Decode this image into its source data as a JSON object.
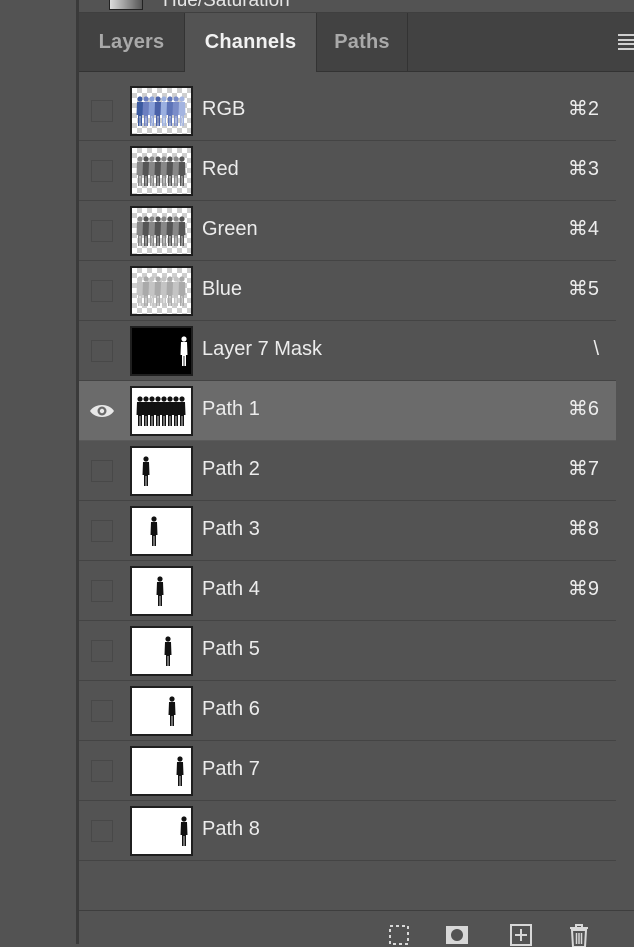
{
  "adjustment": {
    "label": "Hue/Saturation"
  },
  "tabs": [
    {
      "label": "Layers",
      "active": false
    },
    {
      "label": "Channels",
      "active": true
    },
    {
      "label": "Paths",
      "active": false
    }
  ],
  "channels": [
    {
      "name": "RGB",
      "shortcut": "⌘2",
      "visible": false,
      "thumb": "rgb"
    },
    {
      "name": "Red",
      "shortcut": "⌘3",
      "visible": false,
      "thumb": "gray"
    },
    {
      "name": "Green",
      "shortcut": "⌘4",
      "visible": false,
      "thumb": "gray"
    },
    {
      "name": "Blue",
      "shortcut": "⌘5",
      "visible": false,
      "thumb": "light"
    },
    {
      "name": "Layer 7 Mask",
      "shortcut": "\\",
      "visible": false,
      "thumb": "mask"
    },
    {
      "name": "Path 1",
      "shortcut": "⌘6",
      "visible": true,
      "selected": true,
      "thumb": "group"
    },
    {
      "name": "Path 2",
      "shortcut": "⌘7",
      "visible": false,
      "thumb": "single"
    },
    {
      "name": "Path 3",
      "shortcut": "⌘8",
      "visible": false,
      "thumb": "single"
    },
    {
      "name": "Path 4",
      "shortcut": "⌘9",
      "visible": false,
      "thumb": "single"
    },
    {
      "name": "Path 5",
      "shortcut": "",
      "visible": false,
      "thumb": "single"
    },
    {
      "name": "Path 6",
      "shortcut": "",
      "visible": false,
      "thumb": "single"
    },
    {
      "name": "Path 7",
      "shortcut": "",
      "visible": false,
      "thumb": "single"
    },
    {
      "name": "Path 8",
      "shortcut": "",
      "visible": false,
      "thumb": "single"
    }
  ],
  "footer_icons": [
    "load-selection-icon",
    "save-selection-icon",
    "new-channel-icon",
    "delete-icon"
  ],
  "colors": {
    "panel": "#535353",
    "tabbar": "#424242",
    "selected_row": "#6b6b6b",
    "text": "#ececec"
  }
}
